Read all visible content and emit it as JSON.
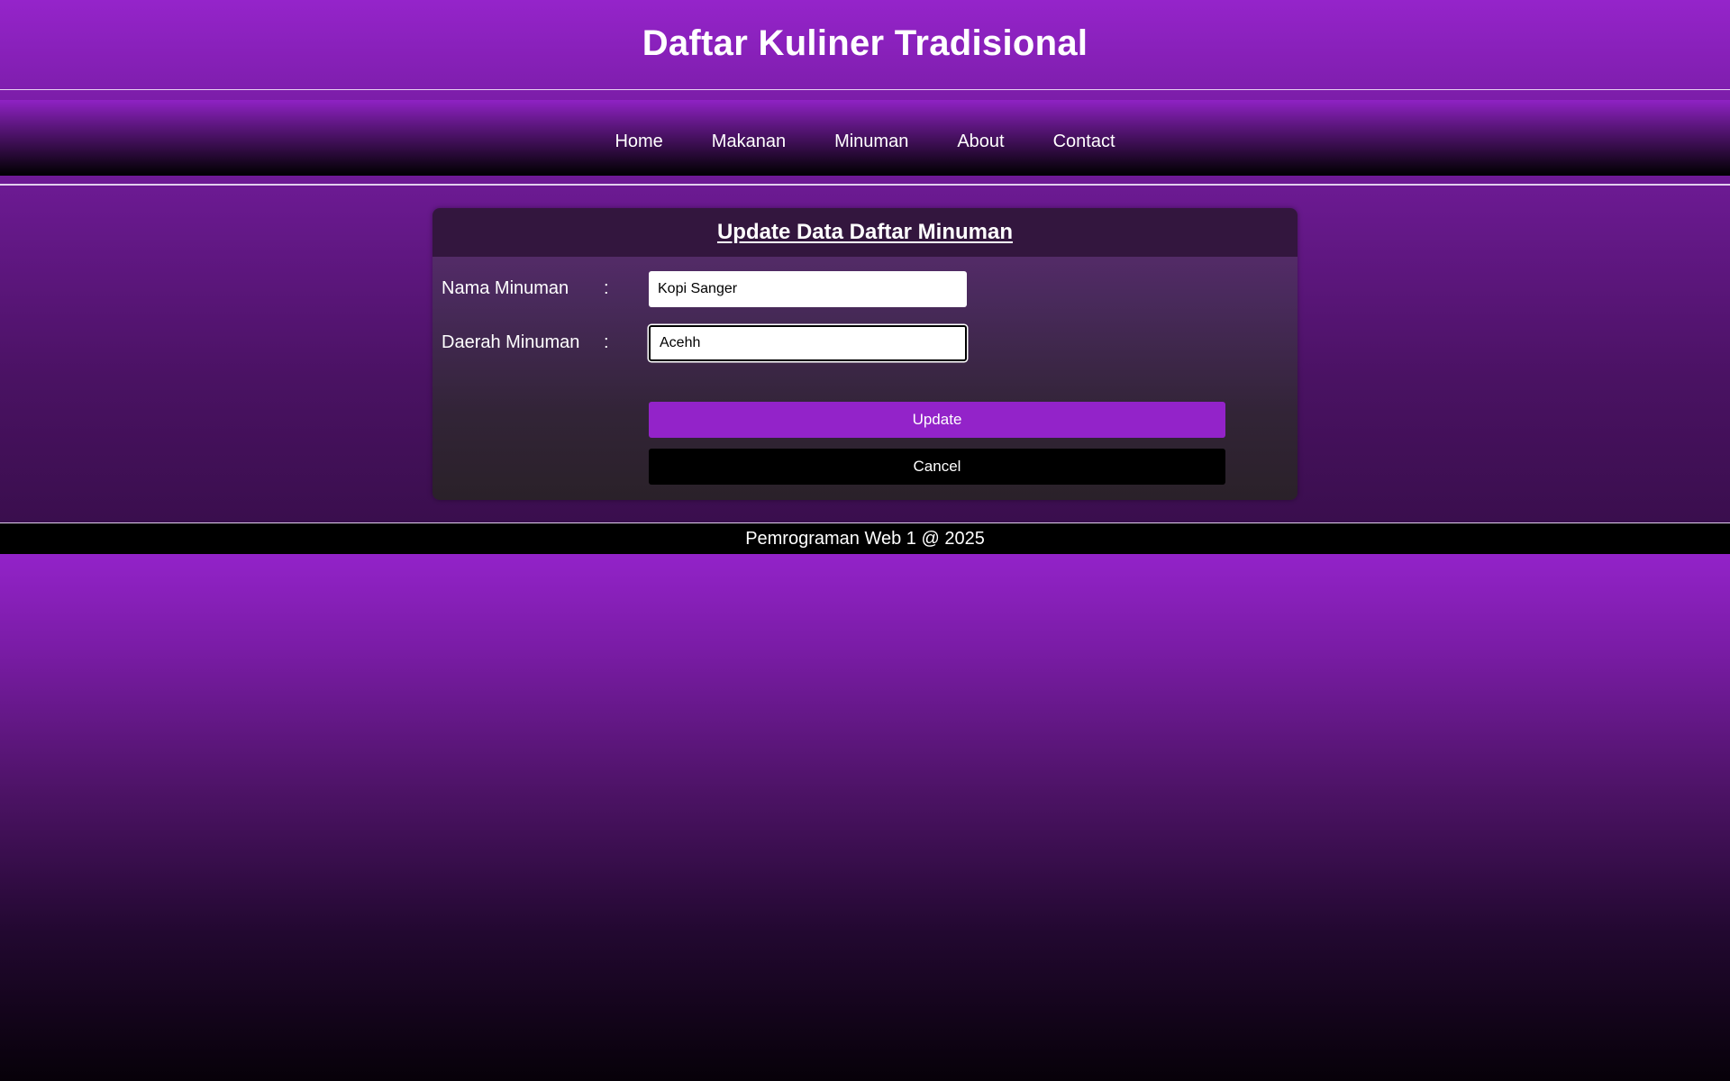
{
  "header": {
    "title": "Daftar Kuliner Tradisional"
  },
  "nav": {
    "items": [
      {
        "label": "Home"
      },
      {
        "label": "Makanan"
      },
      {
        "label": "Minuman"
      },
      {
        "label": "About"
      },
      {
        "label": "Contact"
      }
    ]
  },
  "form": {
    "title": "Update Data Daftar Minuman",
    "fields": [
      {
        "label": "Nama Minuman",
        "colon": ":",
        "value": "Kopi Sanger"
      },
      {
        "label": "Daerah Minuman",
        "colon": ":",
        "value": "Acehh"
      }
    ],
    "update_label": "Update",
    "cancel_label": "Cancel"
  },
  "footer": {
    "text": "Pemrograman Web 1 @ 2025"
  },
  "colors": {
    "accent": "#9323c9",
    "cancel": "#000000",
    "card_header": "#33163e"
  }
}
